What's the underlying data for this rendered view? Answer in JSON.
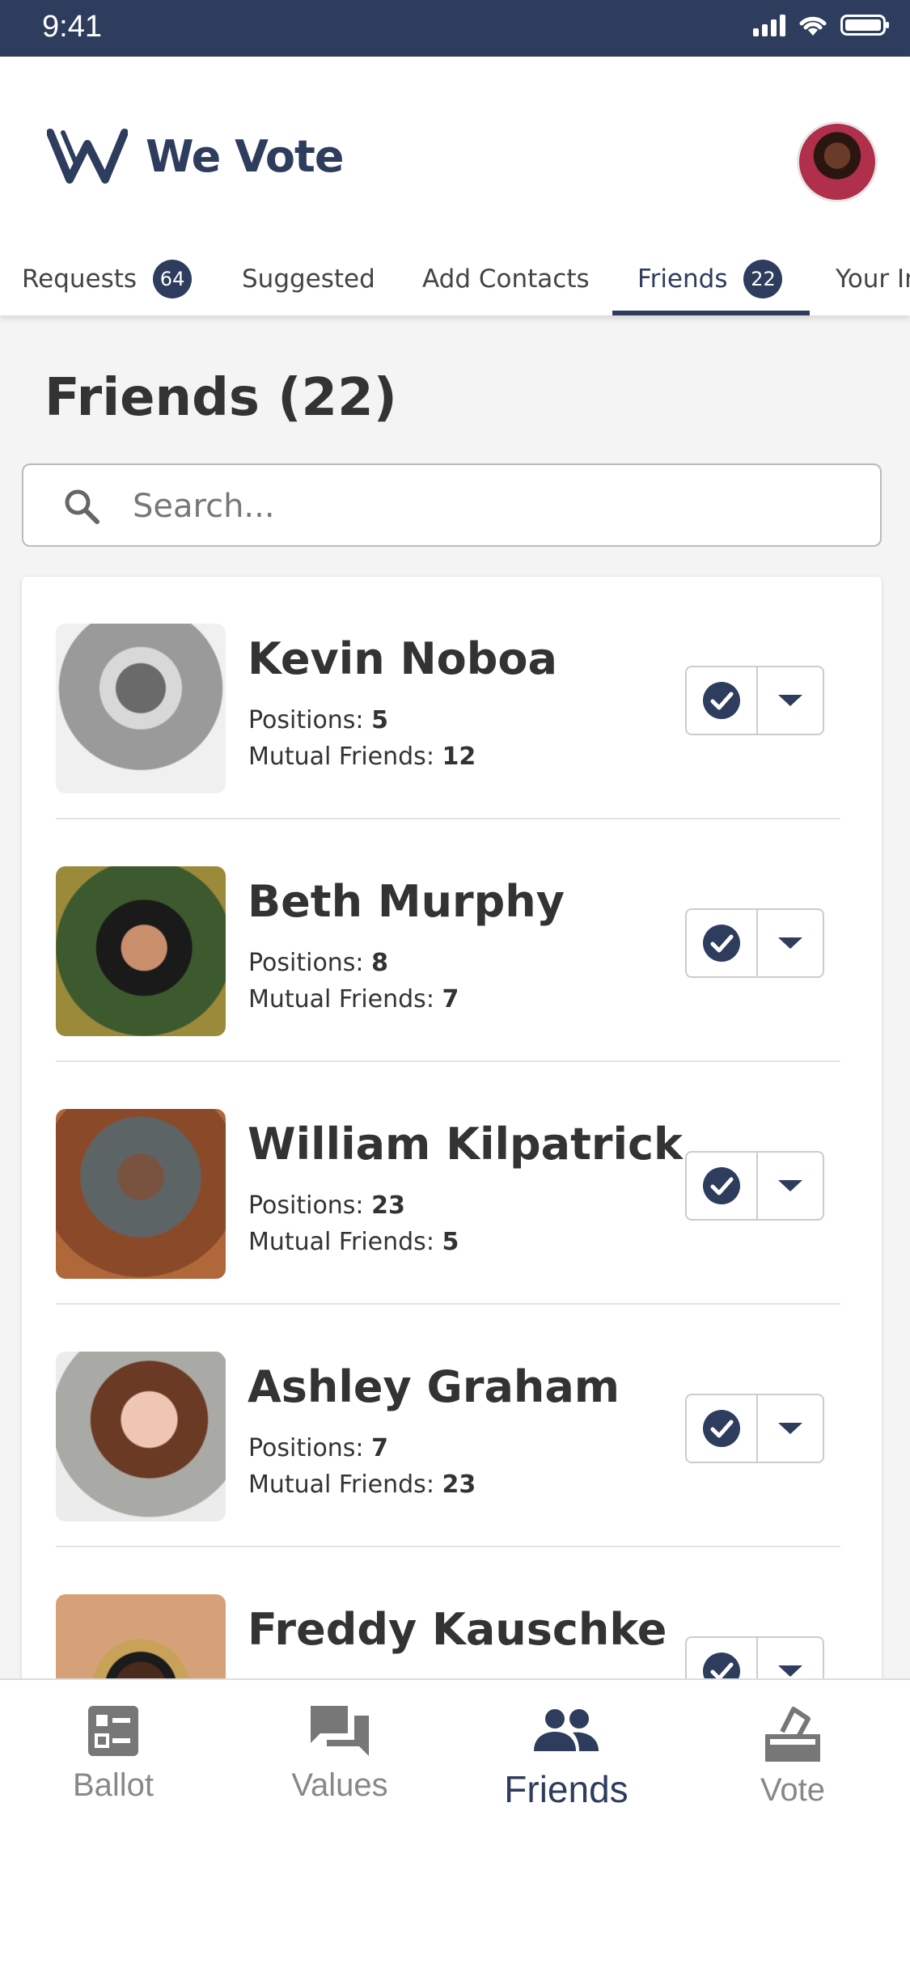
{
  "status_bar": {
    "time": "9:41"
  },
  "app": {
    "name": "We Vote"
  },
  "tabs": [
    {
      "label": "Requests",
      "badge": "64"
    },
    {
      "label": "Suggested"
    },
    {
      "label": "Add Contacts"
    },
    {
      "label": "Friends",
      "badge": "22",
      "active": true
    },
    {
      "label": "Your In"
    }
  ],
  "page_title": "Friends (22)",
  "search": {
    "placeholder": "Search..."
  },
  "stat_labels": {
    "positions": "Positions:",
    "mutual": "Mutual Friends:"
  },
  "friends": [
    {
      "name": "Kevin Noboa",
      "positions": "5",
      "mutual": "12"
    },
    {
      "name": "Beth Murphy",
      "positions": "8",
      "mutual": "7"
    },
    {
      "name": "William Kilpatrick",
      "positions": "23",
      "mutual": "5"
    },
    {
      "name": "Ashley Graham",
      "positions": "7",
      "mutual": "23"
    },
    {
      "name": "Freddy Kauschke"
    }
  ],
  "bottom_nav": [
    {
      "label": "Ballot",
      "icon": "ballot-icon"
    },
    {
      "label": "Values",
      "icon": "chat-bubbles-icon"
    },
    {
      "label": "Friends",
      "icon": "people-icon",
      "active": true
    },
    {
      "label": "Vote",
      "icon": "vote-box-icon"
    }
  ],
  "colors": {
    "brand": "#2e3c5d",
    "background": "#f4f4f4"
  }
}
